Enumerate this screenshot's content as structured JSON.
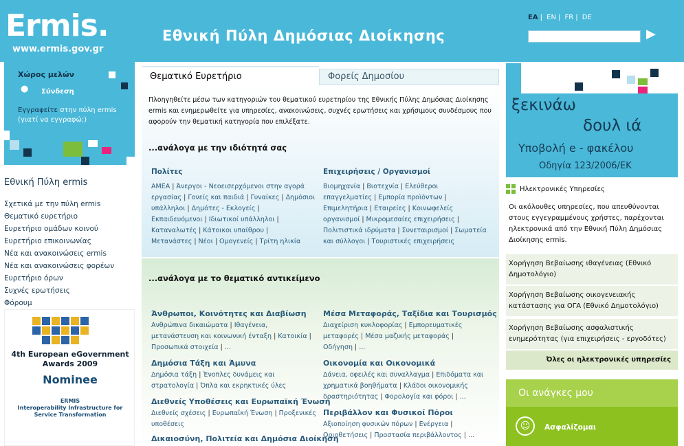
{
  "header": {
    "logo": "Ermis.",
    "logo_url": "www.ermis.gov.gr",
    "site_title": "Εθνική Πύλη Δημόσιας Διοίκησης",
    "languages": [
      "EA",
      "EN",
      "FR",
      "DE"
    ],
    "search_placeholder": ""
  },
  "members": {
    "title": "Χώρος μελών",
    "login": "Σύνδεση",
    "register_text": "Εγγραφείτε",
    "register_link": "στην πύλη ermis",
    "why_link": "(γιατί να εγγραφώ;)"
  },
  "left_nav": {
    "title": "Εθνική Πύλη ermis",
    "items": [
      "Σχετικά με την πύλη ermis",
      "Θεματικό ευρετήριο",
      "Ευρετήριο ομάδων κοινού",
      "Ευρετήριο επικοινωνίας",
      "Νέα και ανακοινώσεις ermis",
      "Νέα και ανακοινώσεις φορέων",
      "Ευρετήριο όρων",
      "Συχνές ερωτήσεις",
      "Φόρουμ"
    ]
  },
  "award": {
    "line1": "4th European eGovernment",
    "line2": "Awards 2009",
    "nominee": "Nominee",
    "sub1": "ERMIS",
    "sub2": "Interoperability Infrastructure for",
    "sub3": "Service Transformation"
  },
  "tabs": {
    "active": "Θεματικό Ευρετήριο",
    "inactive": "Φορείς Δημοσίου"
  },
  "intro": "Πλοηγηθείτε μέσω των κατηγοριών του θεματικού ευρετηρίου της Εθνικής Πύλης Δημόσιας Διοίκησης ermis και ενημερωθείτε για υπηρεσίες, ανακοινώσεις, συχνές ερωτήσεις και χρήσιμους συνδέσμους που αφορούν την θεματική κατηγορία που επιλέξατε.",
  "section1": {
    "title": "...ανάλογα με την ιδιότητά σας",
    "col1": {
      "head": "Πολίτες",
      "links": [
        "ΑΜΕΑ",
        "Άνεργοι - Νεοεισερχόμενοι στην αγορά εργασίας",
        "Γονείς και παιδιά",
        "Γυναίκες",
        "Δημόσιοι υπάλληλοι",
        "Δημότες - Εκλογείς",
        "Εκπαιδευόμενοι",
        "Ιδιωτικοί υπάλληλοι",
        "Καταναλωτές",
        "Κάτοικοι υπαίθρου",
        "Μετανάστες",
        "Νέοι",
        "Ομογενείς",
        "Τρίτη ηλικία"
      ]
    },
    "col2": {
      "head": "Επιχειρήσεις / Οργανισμοί",
      "links": [
        "Βιομηχανία",
        "Βιοτεχνία",
        "Ελεύθεροι επαγγελματίες",
        "Εμπορία προϊόντων",
        "Επιμελητήρια",
        "Εταιρείες",
        "Κοινωφελείς οργανισμοί",
        "Μικρομεσαίες επιχειρήσεις",
        "Πολιτιστικά ιδρύματα",
        "Συνεταιρισμοί",
        "Σωματεία και σύλλογοι",
        "Τουριστικές επιχειρήσεις"
      ]
    }
  },
  "section2": {
    "title": "...ανάλογα με το θεματικό αντικείμενο",
    "topics": [
      {
        "head": "Άνθρωποι, Κοινότητες και Διαβίωση",
        "links": [
          "Ανθρώπινα δικαιώματα",
          "Ιθαγένεια, μετανάστευση και κοινωνική ένταξη",
          "Κατοικία",
          "Προσωπικά στοιχεία",
          "..."
        ]
      },
      {
        "head": "Μέσα Μεταφοράς, Ταξίδια και Τουρισμός",
        "links": [
          "Διαχείριση κυκλοφορίας",
          "Εμπορευματικές μεταφορές",
          "Μέσα μαζικής μεταφοράς",
          "Οδήγηση",
          "..."
        ]
      },
      {
        "head": "Δημόσια Τάξη και Άμυνα",
        "links": [
          "Δημόσια τάξη",
          "Ένοπλες δυνάμεις και στρατολογία",
          "Όπλα και εκρηκτικές ύλες"
        ]
      },
      {
        "head": "Οικονομία και Οικονομικά",
        "links": [
          "Δάνεια, οφειλές και συναλλαγμα",
          "Επιδόματα και χρηματικά βοηθήματα",
          "Κλάδοι οικονομικής δραστηριότητας",
          "Φορολογία και φόροι",
          "..."
        ]
      },
      {
        "head": "Διεθνείς Υποθέσεις και Ευρωπαϊκή Ένωση",
        "links": [
          "Διεθνείς σχέσεις",
          "Ευρωπαϊκή Ένωση",
          "Προξενικές υποθέσεις"
        ]
      },
      {
        "head": "Περιβάλλον και Φυσικοί Πόροι",
        "links": [
          "Αξιοποίηση φυσικών πόρων",
          "Ενέργεια",
          "Οριοθετήσεις",
          "Προστασία περιβάλλοντος",
          "..."
        ]
      },
      {
        "head": "Δικαιοσύνη, Πολιτεία και Δημόσια Διοίκηση",
        "links": []
      }
    ]
  },
  "banner": {
    "t1": "ξεκινάω",
    "t2": "δουλ  ιά",
    "t3": "Υποβολή e - φακέλου",
    "t4": "Οδηγία 123/2006/ΕΚ"
  },
  "eservices": {
    "title": "Ηλεκτρονικές Υπηρεσίες",
    "desc": "Οι ακόλουθες υπηρεσίες, που απευθύνονται στους εγγεγραμμένους χρήστες, παρέχονται ηλεκτρονικά από την Εθνική Πύλη Δημόσιας Διοίκησης ermis.",
    "items": [
      "Χορήγηση Βεβαίωσης ιθαγένειας (Εθνικό Δημοτολόγιο)",
      "Χορήγηση Βεβαίωσης οικογενειακής κατάστασης για ΟΓΑ (Εθνικό Δημοτολόγιο)",
      "Χορήγηση Βεβαίωσης ασφαλιστικής ενημερότητας (για επιχειρήσεις - εργοδότες)"
    ],
    "all": "Όλες οι ηλεκτρονικές υπηρεσίες"
  },
  "needs": {
    "title": "Οι ανάγκες μου",
    "item": "Ασφαλίζομαι"
  },
  "colors": {
    "brand_blue": "#4ab8d9",
    "green": "#8cc11f",
    "link": "#2a5b7a"
  }
}
